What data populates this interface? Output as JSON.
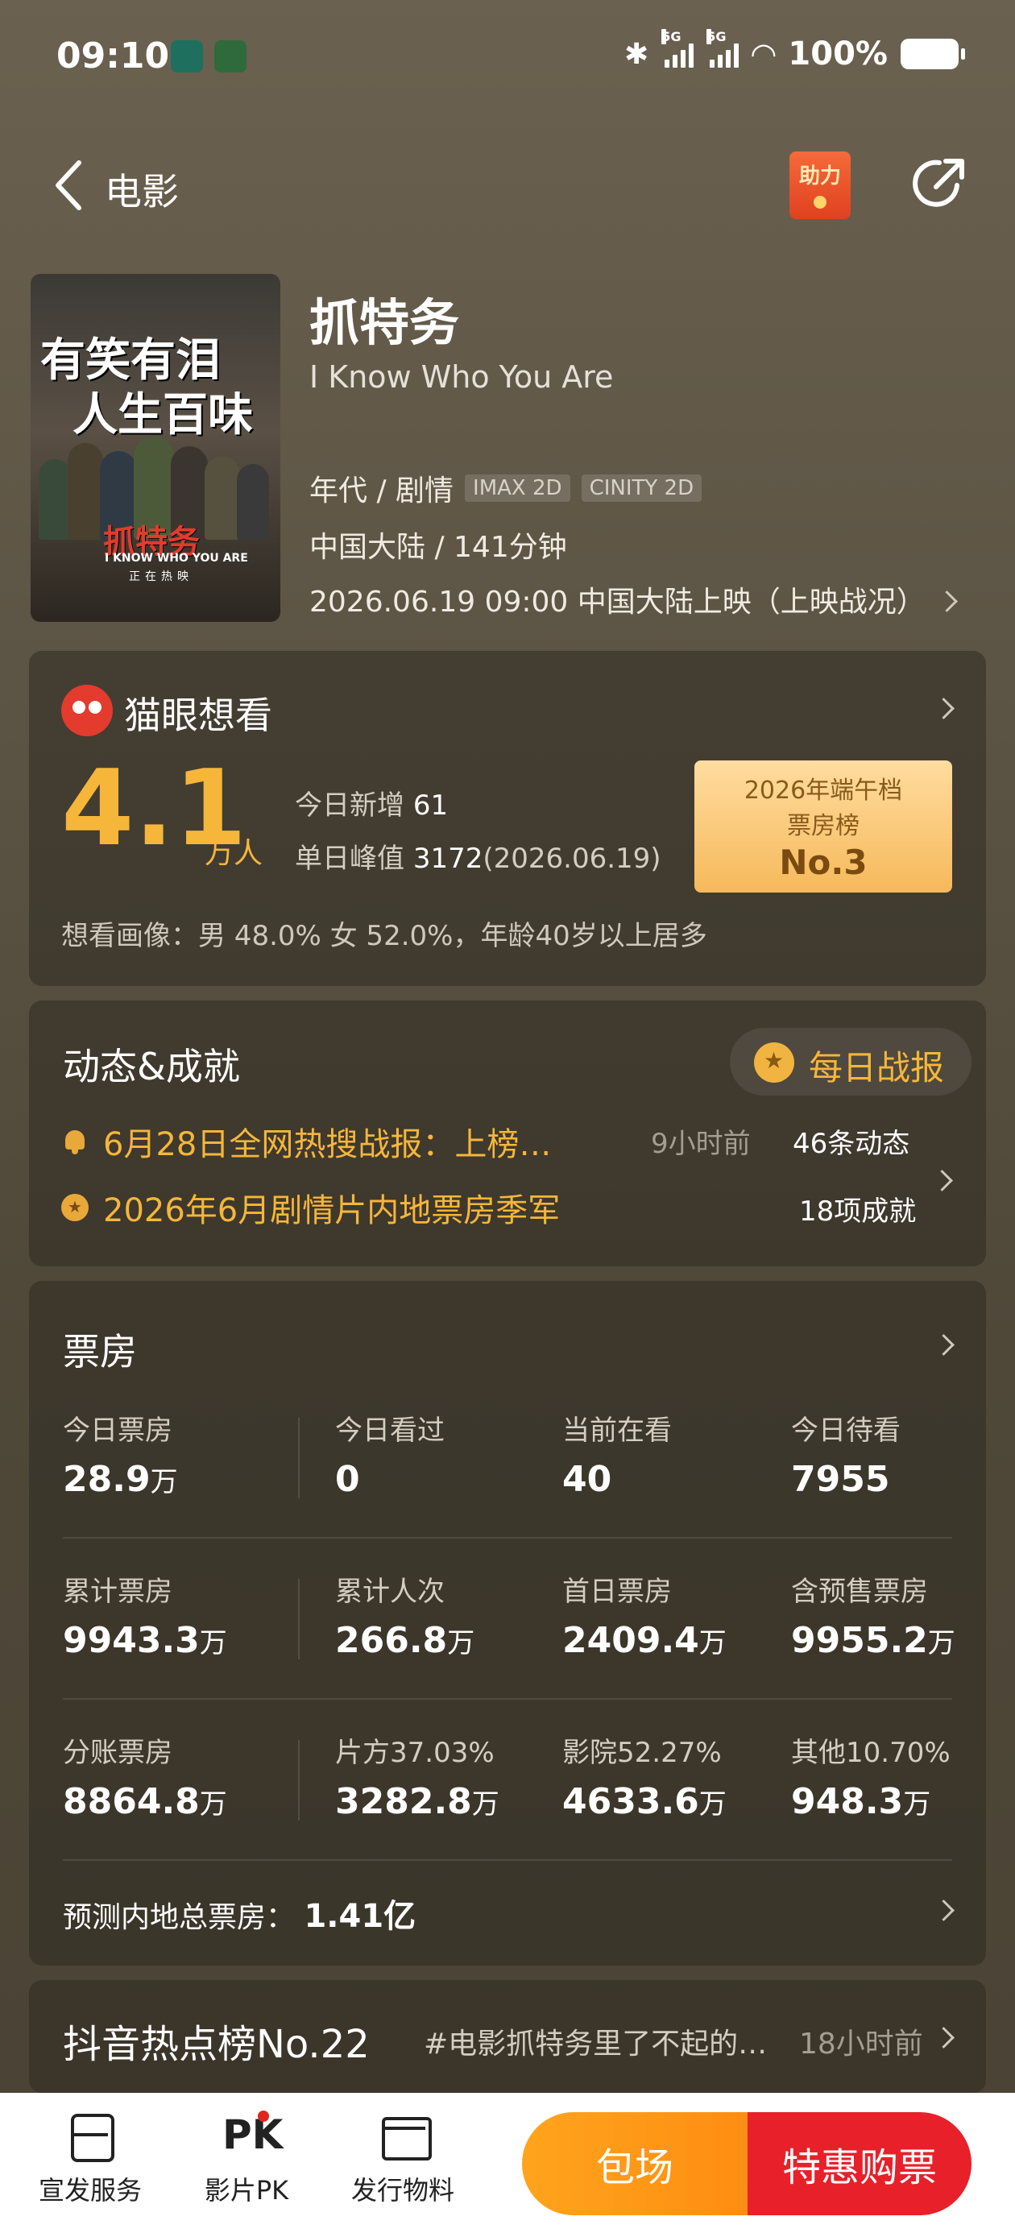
{
  "status_bar": {
    "time": "09:10",
    "network_1": "5G",
    "network_2": "5G",
    "battery": "100%"
  },
  "header": {
    "title": "电影",
    "help_badge": "助力"
  },
  "movie": {
    "title": "抓特务",
    "english_title": "I Know Who You Are",
    "genre": "年代 / 剧情",
    "tags": [
      "IMAX 2D",
      "CINITY 2D"
    ],
    "region_duration": "中国大陆 / 141分钟",
    "release": "2026.06.19 09:00 中国大陆上映（上映战况）",
    "poster": {
      "line1": "有笑有泪",
      "line2": "人生百味",
      "title": "抓特务",
      "english": "I KNOW WHO YOU ARE",
      "sub": "正在热映"
    }
  },
  "want": {
    "title": "猫眼想看",
    "number": "4.1",
    "unit": "万人",
    "today_label": "今日新增",
    "today_value": "61",
    "peak_label": "单日峰值",
    "peak_value": "3172",
    "peak_date": "(2026.06.19)",
    "rank_line1": "2026年端午档",
    "rank_line2": "票房榜",
    "rank_no": "No.3",
    "portrait": "想看画像：男 48.0%  女 52.0%，年龄40岁以上居多"
  },
  "news": {
    "title": "动态&成就",
    "daily_label": "每日战报",
    "item1": "6月28日全网热搜战报：上榜…",
    "item1_time": "9小时前",
    "item1_count": "46条动态",
    "item2": "2026年6月剧情片内地票房季军",
    "item2_count": "18项成就"
  },
  "box_office": {
    "title": "票房",
    "rows": [
      [
        {
          "label": "今日票房",
          "value": "28.9",
          "unit": "万"
        },
        {
          "label": "今日看过",
          "value": "0",
          "unit": ""
        },
        {
          "label": "当前在看",
          "value": "40",
          "unit": ""
        },
        {
          "label": "今日待看",
          "value": "7955",
          "unit": ""
        }
      ],
      [
        {
          "label": "累计票房",
          "value": "9943.3",
          "unit": "万"
        },
        {
          "label": "累计人次",
          "value": "266.8",
          "unit": "万"
        },
        {
          "label": "首日票房",
          "value": "2409.4",
          "unit": "万"
        },
        {
          "label": "含预售票房",
          "value": "9955.2",
          "unit": "万"
        }
      ],
      [
        {
          "label": "分账票房",
          "value": "8864.8",
          "unit": "万"
        },
        {
          "label": "片方37.03%",
          "value": "3282.8",
          "unit": "万"
        },
        {
          "label": "影院52.27%",
          "value": "4633.6",
          "unit": "万"
        },
        {
          "label": "其他10.70%",
          "value": "948.3",
          "unit": "万"
        }
      ]
    ],
    "forecast_label": "预测内地总票房：",
    "forecast_value": "1.41亿"
  },
  "douyin": {
    "title": "抖音热点榜No.22",
    "topic": "#电影抓特务里了不起的…",
    "time": "18小时前"
  },
  "bottom_bar": {
    "tab1": "宣发服务",
    "tab2": "影片PK",
    "tab2_icon": "PK",
    "tab3": "发行物料",
    "book_label": "包场",
    "buy_label": "特惠购票"
  },
  "colors": {
    "accent": "#f5b63a",
    "buy": "#e8202a",
    "book": "#ffa41c"
  }
}
